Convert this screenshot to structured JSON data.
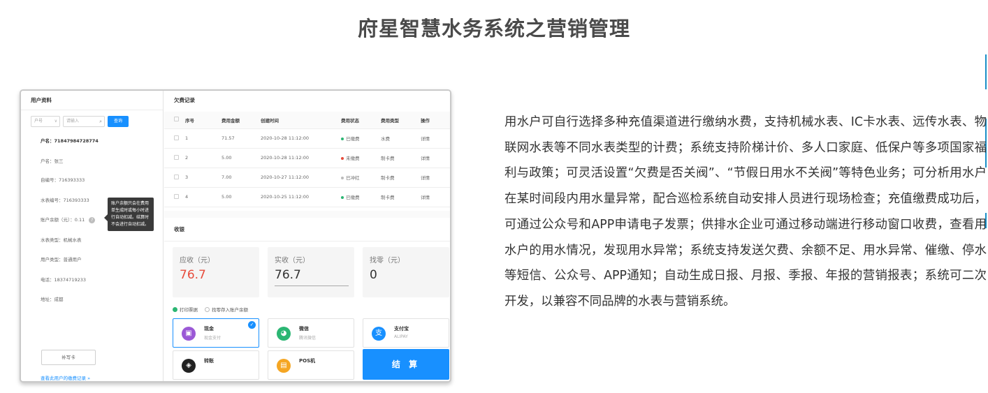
{
  "page_title": "府星智慧水务系统之营销管理",
  "colors": {
    "accent_line": "#1a8fc8",
    "primary": "#1890ff",
    "amount_due": "#e74c3c"
  },
  "user_panel": {
    "title": "用户资料",
    "search": {
      "select_value": "户号",
      "input_placeholder": "请输入",
      "query_label": "查询"
    },
    "fields": {
      "account_no": "户名：71847984728774",
      "name": "户名：张三",
      "self_no": "自编号：716393333",
      "meter_no": "水表编号：716393333",
      "balance": "账户余额（元）：0.11",
      "meter_type": "水表类型：机械水表",
      "user_type": "用户类型：普通用户",
      "phone": "电话：18374719233",
      "address": "地址：成都"
    },
    "tooltip": "账户余额只会在费用单生成时或每小时进行自动扣减。结算时不会进行自动扣减。",
    "reissue_label": "补写卡",
    "records_link": "查看此用户的缴费记录 »"
  },
  "arrears": {
    "title": "欠费记录",
    "columns": [
      "序号",
      "费用金额",
      "创建时间",
      "费用状态",
      "费用类型",
      "操作"
    ],
    "rows": [
      {
        "no": "1",
        "amount": "71.57",
        "created": "2020-10-28 11:12:00",
        "status": "已缴费",
        "status_color": "#2bb673",
        "type": "水费",
        "action": "详情"
      },
      {
        "no": "2",
        "amount": "5.00",
        "created": "2020-10-28 11:12:00",
        "status": "未缴费",
        "status_color": "#e74c3c",
        "type": "制卡费",
        "action": "详情"
      },
      {
        "no": "3",
        "amount": "7.00",
        "created": "2020-10-27 11:12:00",
        "status": "已冲红",
        "status_color": "#bbbbbb",
        "type": "制卡费",
        "action": "详情"
      },
      {
        "no": "4",
        "amount": "5.00",
        "created": "2020-10-25 11:12:00",
        "status": "已缴费",
        "status_color": "#2bb673",
        "type": "制卡费",
        "action": "详情"
      }
    ]
  },
  "cashier": {
    "title": "收银",
    "due": {
      "label": "应收（元）",
      "value": "76.7"
    },
    "received": {
      "label": "实收（元）",
      "value": "76.7"
    },
    "change": {
      "label": "找零（元）",
      "value": "0"
    },
    "options": {
      "print_receipt": "打印票据",
      "deposit_change": "找零存入账户余额"
    },
    "methods": [
      {
        "name": "现金",
        "sub": "现金支付",
        "icon": "wallet-icon",
        "color": "#9b59d6",
        "active": true
      },
      {
        "name": "微信",
        "sub": "腾讯微信",
        "icon": "wechat-icon",
        "color": "#2bb673",
        "active": false
      },
      {
        "name": "支付宝",
        "sub": "ALIPAY",
        "icon": "alipay-icon",
        "color": "#1890ff",
        "active": false
      },
      {
        "name": "转账",
        "sub": "",
        "icon": "transfer-icon",
        "color": "#222222",
        "active": false
      },
      {
        "name": "POS机",
        "sub": "",
        "icon": "pos-icon",
        "color": "#f5a623",
        "active": false
      }
    ],
    "settle_label": "结 算"
  },
  "description": "用水户可自行选择多种充值渠道进行缴纳水费，支持机械水表、IC卡水表、远传水表、物联网水表等不同水表类型的计费；系统支持阶梯计价、多人口家庭、低保户等多项国家福利与政策；可灵活设置“欠费是否关阀”、“节假日用水不关阀”等特色业务；可分析用水户在某时间段内用水量异常，配合巡检系统自动安排人员进行现场检查；充值缴费成功后，可通过公众号和APP申请电子发票；供排水企业可通过移动端进行移动窗口收费，查看用水户的用水情况，发现用水异常；系统支持发送欠费、余额不足、用水异常、催缴、停水等短信、公众号、APP通知；自动生成日报、月报、季报、年报的营销报表；系统可二次开发，以兼容不同品牌的水表与营销系统。"
}
